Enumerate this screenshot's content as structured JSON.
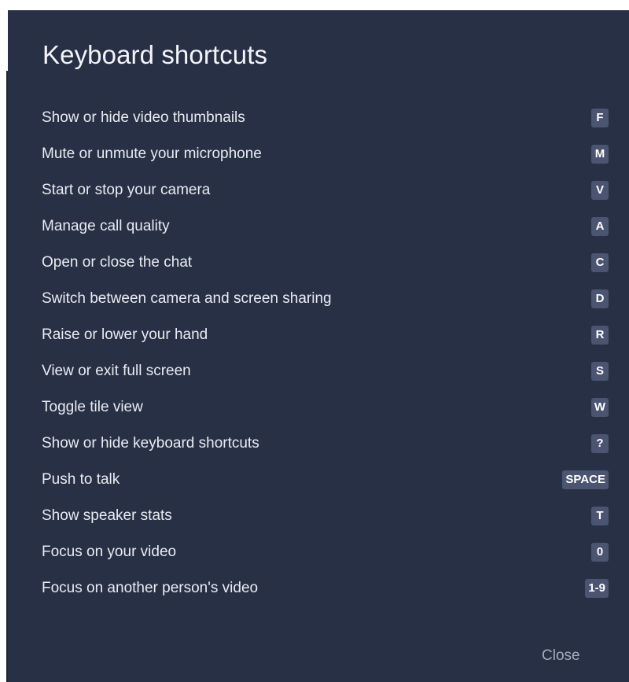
{
  "dialog": {
    "title": "Keyboard shortcuts",
    "close_label": "Close"
  },
  "shortcuts": [
    {
      "label": "Show or hide video thumbnails",
      "key": "F"
    },
    {
      "label": "Mute or unmute your microphone",
      "key": "M"
    },
    {
      "label": "Start or stop your camera",
      "key": "V"
    },
    {
      "label": "Manage call quality",
      "key": "A"
    },
    {
      "label": "Open or close the chat",
      "key": "C"
    },
    {
      "label": "Switch between camera and screen sharing",
      "key": "D"
    },
    {
      "label": "Raise or lower your hand",
      "key": "R"
    },
    {
      "label": "View or exit full screen",
      "key": "S"
    },
    {
      "label": "Toggle tile view",
      "key": "W"
    },
    {
      "label": "Show or hide keyboard shortcuts",
      "key": "?"
    },
    {
      "label": "Push to talk",
      "key": "SPACE"
    },
    {
      "label": "Show speaker stats",
      "key": "T"
    },
    {
      "label": "Focus on your video",
      "key": "0"
    },
    {
      "label": "Focus on another person's video",
      "key": "1-9"
    }
  ],
  "colors": {
    "dialog_background": "#283045",
    "key_background": "#4b5571",
    "close_text": "#a4acbd"
  }
}
